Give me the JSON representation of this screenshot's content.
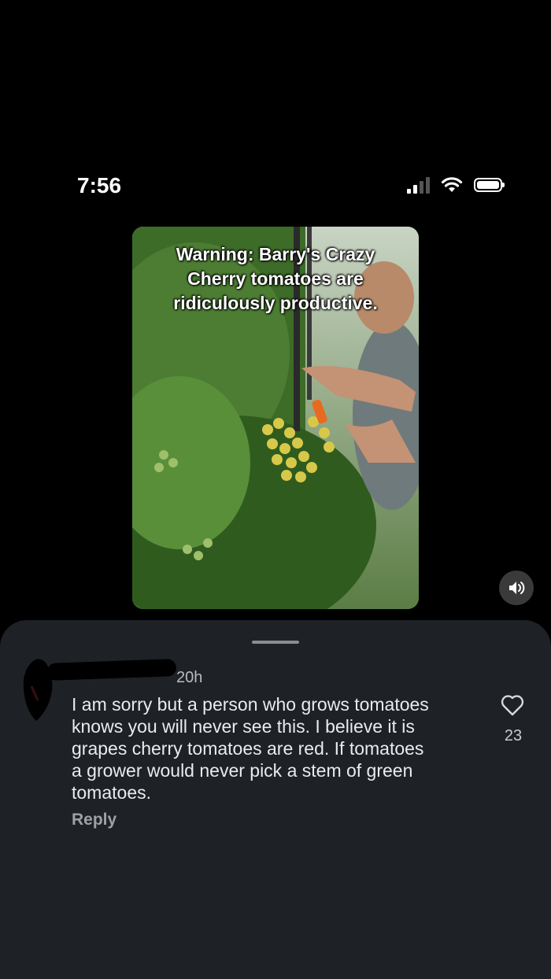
{
  "status": {
    "time": "7:56"
  },
  "video": {
    "caption_lines": [
      "Warning: Barry's Crazy",
      "Cherry tomatoes are",
      "ridiculously productive."
    ]
  },
  "comment": {
    "age": "20h",
    "lines": [
      "I am sorry but a person who grows tomatoes",
      "knows you will never see this. I believe it is",
      "grapes  cherry tomatoes are red. If tomatoes",
      "a grower would never pick a stem of green",
      "tomatoes."
    ],
    "reply_label": "Reply",
    "like_count": "23"
  },
  "icons": {
    "signal": "cellular-signal-icon",
    "wifi": "wifi-icon",
    "battery": "battery-icon",
    "volume": "speaker-volume-icon",
    "like": "heart-icon"
  }
}
